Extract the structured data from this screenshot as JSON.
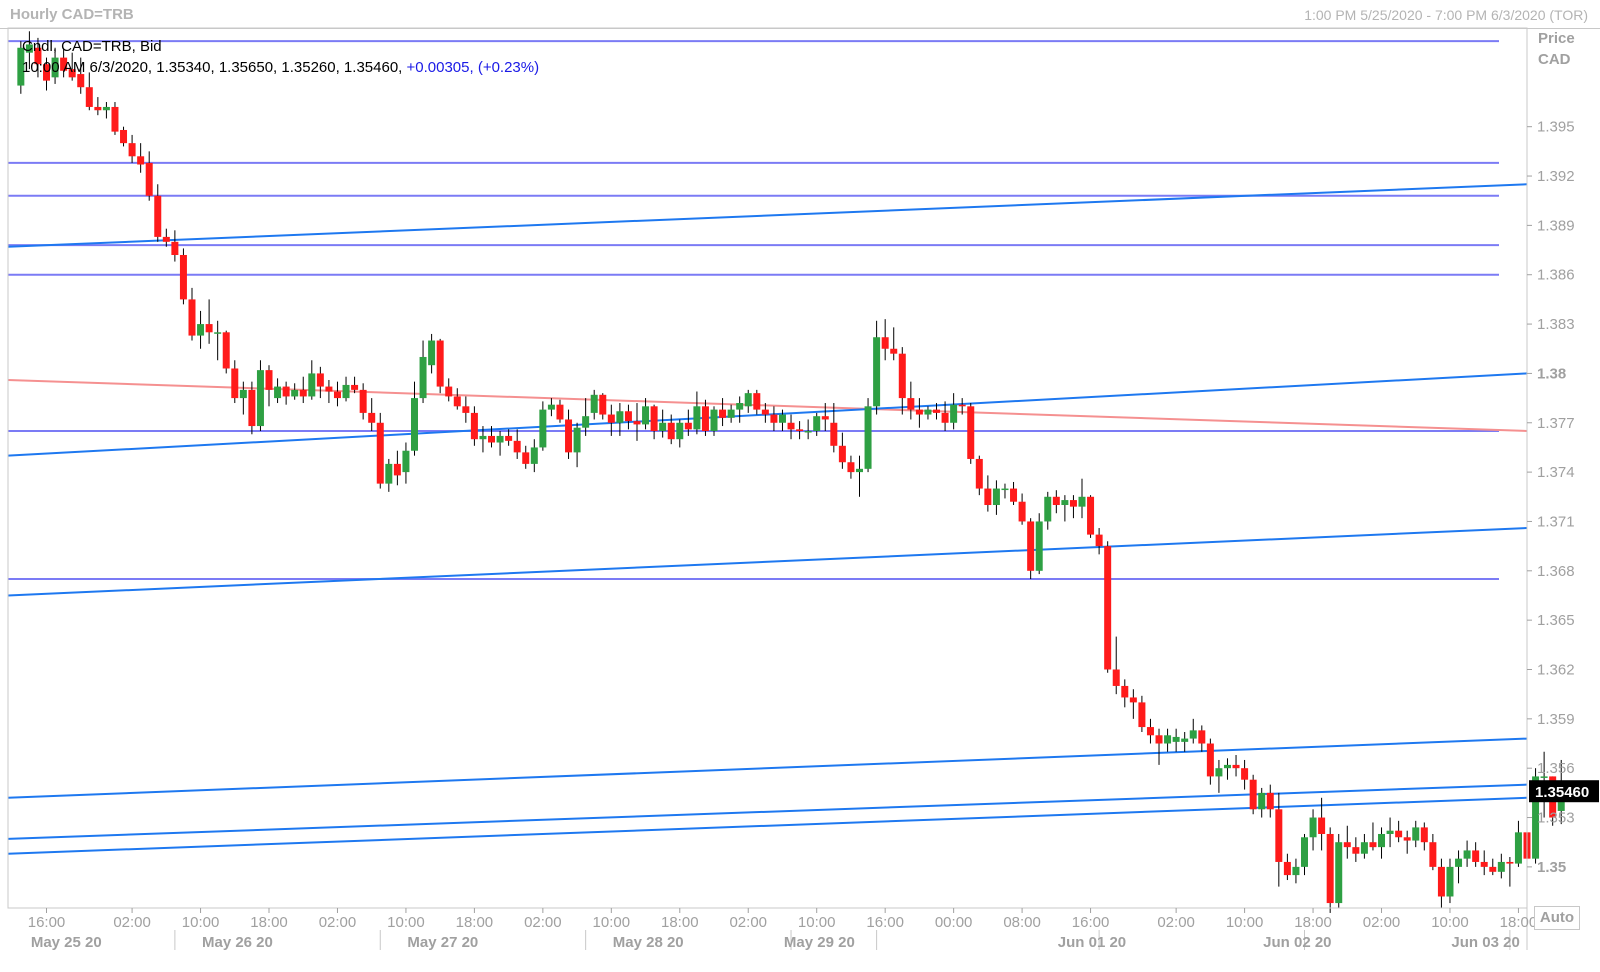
{
  "header": {
    "title": "Hourly CAD=TRB",
    "range": "1:00 PM 5/25/2020 - 7:00 PM 6/3/2020 (TOR)"
  },
  "legend": {
    "line1": "Cndl, CAD=TRB, Bid",
    "ohlc": "10:00 AM 6/3/2020, 1.35340, 1.35650, 1.35260, 1.35460,",
    "change": "+0.00305,",
    "change_pct": "(+0.23%)"
  },
  "y_axis": {
    "label": "Price",
    "currency": "CAD",
    "last_price": "1.35460",
    "auto_label": "Auto"
  },
  "colors": {
    "up": "#2ea043",
    "down": "#ff1a1a",
    "trendline": "#1e78f0",
    "horizontal": "#7b7bf5",
    "pink_line": "#f59090",
    "price_label_bg": "#000000"
  },
  "chart_data": {
    "type": "candlestick",
    "title": "Hourly CAD=TRB",
    "series_name": "CAD=TRB, Bid",
    "ylim": [
      1.3475,
      1.401
    ],
    "y_ticks": [
      {
        "value": 1.395,
        "label": "1.395"
      },
      {
        "value": 1.392,
        "label": "1.392"
      },
      {
        "value": 1.389,
        "label": "1.389"
      },
      {
        "value": 1.386,
        "label": "1.386"
      },
      {
        "value": 1.383,
        "label": "1.383"
      },
      {
        "value": 1.38,
        "label": "1.38"
      },
      {
        "value": 1.377,
        "label": "1.377"
      },
      {
        "value": 1.374,
        "label": "1.374"
      },
      {
        "value": 1.371,
        "label": "1.371"
      },
      {
        "value": 1.368,
        "label": "1.368"
      },
      {
        "value": 1.365,
        "label": "1.365"
      },
      {
        "value": 1.362,
        "label": "1.362"
      },
      {
        "value": 1.359,
        "label": "1.359"
      },
      {
        "value": 1.356,
        "label": "1.356"
      },
      {
        "value": 1.353,
        "label": "1.353"
      },
      {
        "value": 1.35,
        "label": "1.35"
      }
    ],
    "x_ticks": [
      {
        "hour": 3,
        "label": "16:00"
      },
      {
        "hour": 13,
        "label": "02:00"
      },
      {
        "hour": 21,
        "label": "10:00"
      },
      {
        "hour": 29,
        "label": "18:00"
      },
      {
        "hour": 37,
        "label": "02:00"
      },
      {
        "hour": 45,
        "label": "10:00"
      },
      {
        "hour": 53,
        "label": "18:00"
      },
      {
        "hour": 61,
        "label": "02:00"
      },
      {
        "hour": 69,
        "label": "10:00"
      },
      {
        "hour": 77,
        "label": "18:00"
      },
      {
        "hour": 85,
        "label": "02:00"
      },
      {
        "hour": 93,
        "label": "10:00"
      },
      {
        "hour": 101,
        "label": "16:00"
      },
      {
        "hour": 109,
        "label": "00:00"
      },
      {
        "hour": 117,
        "label": "08:00"
      },
      {
        "hour": 125,
        "label": "16:00"
      },
      {
        "hour": 135,
        "label": "02:00"
      },
      {
        "hour": 143,
        "label": "10:00"
      },
      {
        "hour": 151,
        "label": "18:00"
      },
      {
        "hour": 159,
        "label": "02:00"
      },
      {
        "hour": 167,
        "label": "10:00"
      },
      {
        "hour": 175,
        "label": "18:00"
      }
    ],
    "date_labels": [
      {
        "hour": 0,
        "label": "May 25 20"
      },
      {
        "hour": 20,
        "label": "May 26 20"
      },
      {
        "hour": 44,
        "label": "May 27 20"
      },
      {
        "hour": 68,
        "label": "May 28 20"
      },
      {
        "hour": 88,
        "label": "May 29 20"
      },
      {
        "hour": 120,
        "label": "Jun 01 20"
      },
      {
        "hour": 144,
        "label": "Jun 02 20"
      },
      {
        "hour": 166,
        "label": "Jun 03 20"
      }
    ],
    "date_separators": [
      18,
      42,
      66,
      90,
      100,
      126,
      150,
      174
    ],
    "x_range": [
      -1.5,
      176
    ],
    "candles": [
      [
        1.3975,
        1.4002,
        1.397,
        1.3998
      ],
      [
        1.3995,
        1.4008,
        1.3985,
        1.4
      ],
      [
        1.3998,
        1.4004,
        1.398,
        1.3988
      ],
      [
        1.3988,
        1.3992,
        1.3972,
        1.3978
      ],
      [
        1.398,
        1.3998,
        1.3976,
        1.3992
      ],
      [
        1.3992,
        1.3997,
        1.398,
        1.3984
      ],
      [
        1.3985,
        1.3995,
        1.3978,
        1.398
      ],
      [
        1.3982,
        1.3992,
        1.397,
        1.3974
      ],
      [
        1.3974,
        1.3983,
        1.396,
        1.3962
      ],
      [
        1.3962,
        1.3968,
        1.3957,
        1.396
      ],
      [
        1.396,
        1.3965,
        1.3955,
        1.3962
      ],
      [
        1.3962,
        1.3965,
        1.3945,
        1.3947
      ],
      [
        1.3948,
        1.395,
        1.3938,
        1.394
      ],
      [
        1.394,
        1.3945,
        1.3928,
        1.3932
      ],
      [
        1.3932,
        1.394,
        1.3922,
        1.3927
      ],
      [
        1.3928,
        1.3935,
        1.3905,
        1.3908
      ],
      [
        1.3908,
        1.3915,
        1.388,
        1.3883
      ],
      [
        1.3883,
        1.3888,
        1.3877,
        1.388
      ],
      [
        1.388,
        1.3887,
        1.3868,
        1.3872
      ],
      [
        1.3872,
        1.3876,
        1.3842,
        1.3845
      ],
      [
        1.3845,
        1.3852,
        1.382,
        1.3823
      ],
      [
        1.3823,
        1.3838,
        1.3815,
        1.383
      ],
      [
        1.383,
        1.3845,
        1.3818,
        1.3825
      ],
      [
        1.3825,
        1.3832,
        1.3808,
        1.3825
      ],
      [
        1.3825,
        1.3826,
        1.38,
        1.3803
      ],
      [
        1.3803,
        1.3808,
        1.3782,
        1.3785
      ],
      [
        1.3785,
        1.3795,
        1.3775,
        1.379
      ],
      [
        1.379,
        1.3795,
        1.3763,
        1.3768
      ],
      [
        1.3768,
        1.3808,
        1.3765,
        1.3802
      ],
      [
        1.3802,
        1.3805,
        1.378,
        1.379
      ],
      [
        1.3785,
        1.3797,
        1.3782,
        1.3792
      ],
      [
        1.3792,
        1.3795,
        1.3781,
        1.3786
      ],
      [
        1.3786,
        1.3794,
        1.3784,
        1.379
      ],
      [
        1.379,
        1.3798,
        1.3782,
        1.3786
      ],
      [
        1.3786,
        1.3808,
        1.3784,
        1.38
      ],
      [
        1.38,
        1.3804,
        1.3785,
        1.3792
      ],
      [
        1.3792,
        1.3796,
        1.3782,
        1.3789
      ],
      [
        1.3789,
        1.3795,
        1.378,
        1.3785
      ],
      [
        1.3785,
        1.3798,
        1.3783,
        1.3793
      ],
      [
        1.3793,
        1.3798,
        1.3788,
        1.379
      ],
      [
        1.379,
        1.3794,
        1.3772,
        1.3776
      ],
      [
        1.3776,
        1.3785,
        1.3765,
        1.377
      ],
      [
        1.377,
        1.3776,
        1.373,
        1.3733
      ],
      [
        1.3733,
        1.3748,
        1.3728,
        1.3745
      ],
      [
        1.3745,
        1.3753,
        1.3732,
        1.3738
      ],
      [
        1.374,
        1.3758,
        1.3733,
        1.3753
      ],
      [
        1.3753,
        1.3795,
        1.375,
        1.3785
      ],
      [
        1.3785,
        1.382,
        1.3782,
        1.381
      ],
      [
        1.3805,
        1.3824,
        1.38,
        1.382
      ],
      [
        1.382,
        1.3821,
        1.3788,
        1.3792
      ],
      [
        1.3792,
        1.3797,
        1.3783,
        1.3786
      ],
      [
        1.3786,
        1.3791,
        1.3778,
        1.378
      ],
      [
        1.378,
        1.3786,
        1.377,
        1.3776
      ],
      [
        1.3776,
        1.378,
        1.3756,
        1.376
      ],
      [
        1.376,
        1.3768,
        1.3752,
        1.3762
      ],
      [
        1.3762,
        1.3768,
        1.3755,
        1.3758
      ],
      [
        1.3758,
        1.3765,
        1.375,
        1.3762
      ],
      [
        1.3762,
        1.3766,
        1.3756,
        1.3759
      ],
      [
        1.3759,
        1.3766,
        1.3748,
        1.3752
      ],
      [
        1.3752,
        1.3756,
        1.3742,
        1.3745
      ],
      [
        1.3745,
        1.376,
        1.374,
        1.3755
      ],
      [
        1.3755,
        1.3783,
        1.3753,
        1.3778
      ],
      [
        1.3778,
        1.3785,
        1.3774,
        1.3781
      ],
      [
        1.3781,
        1.3784,
        1.377,
        1.3772
      ],
      [
        1.3772,
        1.3778,
        1.3748,
        1.3752
      ],
      [
        1.3752,
        1.377,
        1.3743,
        1.3767
      ],
      [
        1.3767,
        1.3785,
        1.3762,
        1.3774
      ],
      [
        1.3776,
        1.379,
        1.3772,
        1.3787
      ],
      [
        1.3787,
        1.3788,
        1.3772,
        1.3775
      ],
      [
        1.3775,
        1.3781,
        1.3762,
        1.377
      ],
      [
        1.377,
        1.3782,
        1.3762,
        1.3777
      ],
      [
        1.3777,
        1.3781,
        1.3766,
        1.3771
      ],
      [
        1.3771,
        1.3782,
        1.3759,
        1.3769
      ],
      [
        1.3769,
        1.3785,
        1.3766,
        1.378
      ],
      [
        1.378,
        1.3781,
        1.376,
        1.3765
      ],
      [
        1.3765,
        1.3778,
        1.3761,
        1.377
      ],
      [
        1.377,
        1.3775,
        1.3757,
        1.376
      ],
      [
        1.376,
        1.3772,
        1.3755,
        1.377
      ],
      [
        1.377,
        1.3778,
        1.3762,
        1.3766
      ],
      [
        1.3766,
        1.3789,
        1.3763,
        1.378
      ],
      [
        1.378,
        1.3784,
        1.3762,
        1.3765
      ],
      [
        1.3765,
        1.378,
        1.3762,
        1.3778
      ],
      [
        1.3778,
        1.3785,
        1.3768,
        1.3773
      ],
      [
        1.3773,
        1.3781,
        1.377,
        1.3778
      ],
      [
        1.3778,
        1.3786,
        1.377,
        1.3782
      ],
      [
        1.378,
        1.379,
        1.3776,
        1.3788
      ],
      [
        1.3788,
        1.379,
        1.3775,
        1.3778
      ],
      [
        1.3778,
        1.3782,
        1.377,
        1.3775
      ],
      [
        1.3775,
        1.378,
        1.3765,
        1.377
      ],
      [
        1.377,
        1.3778,
        1.3765,
        1.3775
      ],
      [
        1.377,
        1.3775,
        1.376,
        1.3766
      ],
      [
        1.3766,
        1.3771,
        1.376,
        1.3765
      ],
      [
        1.3765,
        1.3772,
        1.376,
        1.3765
      ],
      [
        1.3765,
        1.3776,
        1.3762,
        1.3774
      ],
      [
        1.3774,
        1.3782,
        1.3765,
        1.3772
      ],
      [
        1.377,
        1.3782,
        1.3752,
        1.3756
      ],
      [
        1.3756,
        1.3764,
        1.3742,
        1.3746
      ],
      [
        1.3746,
        1.375,
        1.3736,
        1.374
      ],
      [
        1.374,
        1.375,
        1.3725,
        1.3742
      ],
      [
        1.3742,
        1.3785,
        1.374,
        1.378
      ],
      [
        1.378,
        1.3832,
        1.3775,
        1.3822
      ],
      [
        1.3822,
        1.3833,
        1.3808,
        1.3815
      ],
      [
        1.3815,
        1.3828,
        1.3808,
        1.3812
      ],
      [
        1.3812,
        1.3816,
        1.3775,
        1.3785
      ],
      [
        1.3785,
        1.3795,
        1.3772,
        1.3778
      ],
      [
        1.3778,
        1.3785,
        1.3767,
        1.3775
      ],
      [
        1.3775,
        1.378,
        1.3772,
        1.3778
      ],
      [
        1.3778,
        1.3782,
        1.3772,
        1.3776
      ],
      [
        1.3776,
        1.3783,
        1.3765,
        1.377
      ],
      [
        1.377,
        1.3788,
        1.3766,
        1.3781
      ],
      [
        1.3781,
        1.3785,
        1.3775,
        1.378
      ],
      [
        1.378,
        1.3782,
        1.3745,
        1.3748
      ],
      [
        1.3748,
        1.375,
        1.3726,
        1.373
      ],
      [
        1.373,
        1.3738,
        1.3716,
        1.372
      ],
      [
        1.372,
        1.3735,
        1.3714,
        1.373
      ],
      [
        1.373,
        1.3733,
        1.3724,
        1.373
      ],
      [
        1.373,
        1.3734,
        1.372,
        1.3722
      ],
      [
        1.3722,
        1.3727,
        1.3708,
        1.371
      ],
      [
        1.371,
        1.3712,
        1.3675,
        1.368
      ],
      [
        1.368,
        1.3715,
        1.3678,
        1.371
      ],
      [
        1.371,
        1.3728,
        1.3705,
        1.3725
      ],
      [
        1.3725,
        1.3729,
        1.3715,
        1.372
      ],
      [
        1.372,
        1.3726,
        1.371,
        1.3723
      ],
      [
        1.3723,
        1.3726,
        1.3712,
        1.3719
      ],
      [
        1.3719,
        1.3736,
        1.3712,
        1.3725
      ],
      [
        1.3725,
        1.3726,
        1.37,
        1.3702
      ],
      [
        1.3702,
        1.3706,
        1.369,
        1.3695
      ],
      [
        1.3695,
        1.3698,
        1.3618,
        1.362
      ],
      [
        1.362,
        1.364,
        1.3605,
        1.361
      ],
      [
        1.361,
        1.3614,
        1.3597,
        1.3603
      ],
      [
        1.3603,
        1.3608,
        1.359,
        1.36
      ],
      [
        1.36,
        1.3604,
        1.3582,
        1.3585
      ],
      [
        1.3585,
        1.359,
        1.3575,
        1.358
      ],
      [
        1.358,
        1.3584,
        1.3562,
        1.3575
      ],
      [
        1.3575,
        1.3584,
        1.357,
        1.358
      ],
      [
        1.3576,
        1.3584,
        1.357,
        1.3579
      ],
      [
        1.3576,
        1.3582,
        1.357,
        1.3578
      ],
      [
        1.3578,
        1.359,
        1.3575,
        1.3583
      ],
      [
        1.3583,
        1.3586,
        1.357,
        1.3575
      ],
      [
        1.3575,
        1.3578,
        1.355,
        1.3555
      ],
      [
        1.3555,
        1.3565,
        1.3545,
        1.356
      ],
      [
        1.356,
        1.3566,
        1.3553,
        1.3562
      ],
      [
        1.3562,
        1.3568,
        1.3555,
        1.356
      ],
      [
        1.356,
        1.3565,
        1.3547,
        1.3553
      ],
      [
        1.3553,
        1.3556,
        1.3532,
        1.3535
      ],
      [
        1.3535,
        1.3548,
        1.353,
        1.3545
      ],
      [
        1.3545,
        1.355,
        1.353,
        1.3535
      ],
      [
        1.3535,
        1.3545,
        1.3488,
        1.3503
      ],
      [
        1.3503,
        1.3508,
        1.3492,
        1.3495
      ],
      [
        1.3495,
        1.3505,
        1.349,
        1.35
      ],
      [
        1.35,
        1.352,
        1.3495,
        1.3518
      ],
      [
        1.3518,
        1.3535,
        1.351,
        1.353
      ],
      [
        1.353,
        1.3542,
        1.351,
        1.352
      ],
      [
        1.352,
        1.3524,
        1.3472,
        1.3478
      ],
      [
        1.3478,
        1.352,
        1.3475,
        1.3515
      ],
      [
        1.3515,
        1.3525,
        1.3505,
        1.3512
      ],
      [
        1.3512,
        1.3518,
        1.3503,
        1.3508
      ],
      [
        1.3508,
        1.352,
        1.3505,
        1.3515
      ],
      [
        1.3515,
        1.3527,
        1.351,
        1.3512
      ],
      [
        1.3512,
        1.3524,
        1.3505,
        1.352
      ],
      [
        1.352,
        1.353,
        1.3512,
        1.3522
      ],
      [
        1.3522,
        1.3528,
        1.3515,
        1.3518
      ],
      [
        1.3518,
        1.3522,
        1.3508,
        1.3516
      ],
      [
        1.3516,
        1.3528,
        1.3512,
        1.3524
      ],
      [
        1.3524,
        1.3527,
        1.351,
        1.3515
      ],
      [
        1.3515,
        1.352,
        1.3498,
        1.35
      ],
      [
        1.35,
        1.3505,
        1.3475,
        1.3482
      ],
      [
        1.3482,
        1.3505,
        1.3478,
        1.35
      ],
      [
        1.35,
        1.351,
        1.349,
        1.3505
      ],
      [
        1.3505,
        1.3516,
        1.35,
        1.351
      ],
      [
        1.351,
        1.3515,
        1.35,
        1.3503
      ],
      [
        1.3503,
        1.351,
        1.3495,
        1.35
      ],
      [
        1.35,
        1.3505,
        1.3495,
        1.3497
      ],
      [
        1.3497,
        1.3508,
        1.3493,
        1.3503
      ],
      [
        1.3503,
        1.3506,
        1.3488,
        1.3502
      ],
      [
        1.3502,
        1.3528,
        1.35,
        1.3521
      ],
      [
        1.3521,
        1.353,
        1.3502,
        1.3505
      ],
      [
        1.3505,
        1.356,
        1.3502,
        1.3555
      ],
      [
        1.3555,
        1.357,
        1.353,
        1.3555
      ],
      [
        1.3555,
        1.3555,
        1.3525,
        1.353
      ],
      [
        1.3534,
        1.3565,
        1.3526,
        1.3546
      ]
    ],
    "horizontal_lines": [
      1.4002,
      1.3928,
      1.3908,
      1.3878,
      1.386,
      1.3765,
      1.3675
    ],
    "trend_lines": [
      {
        "from": [
          1.3877,
          -1.5
        ],
        "to": [
          1.3915,
          176
        ]
      },
      {
        "from": [
          1.375,
          -1.5
        ],
        "to": [
          1.38,
          176
        ]
      },
      {
        "from": [
          1.3665,
          -1.5
        ],
        "to": [
          1.3706,
          176
        ]
      },
      {
        "from": [
          1.3542,
          -1.5
        ],
        "to": [
          1.3578,
          176
        ]
      },
      {
        "from": [
          1.3517,
          -1.5
        ],
        "to": [
          1.355,
          176
        ]
      },
      {
        "from": [
          1.3508,
          -1.5
        ],
        "to": [
          1.3542,
          176
        ]
      }
    ],
    "pink_line": {
      "from": [
        1.3796,
        -1.5
      ],
      "to": [
        1.3765,
        176
      ]
    }
  }
}
